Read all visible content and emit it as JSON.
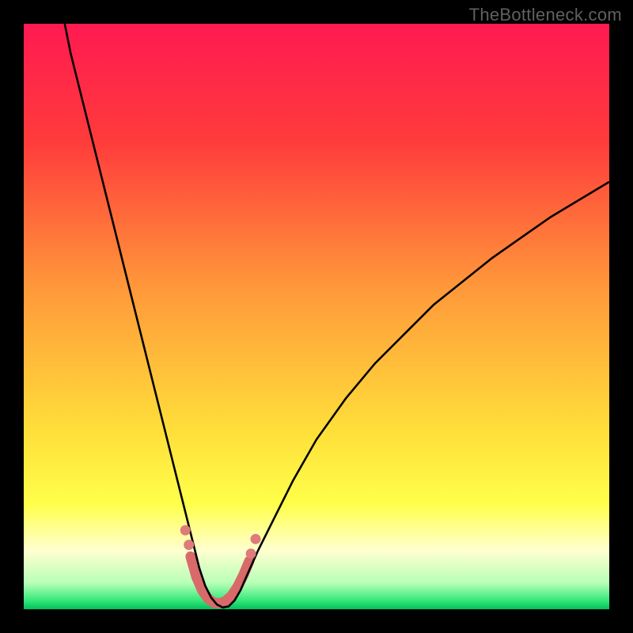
{
  "watermark": "TheBottleneck.com",
  "chart_data": {
    "type": "line",
    "title": "",
    "xlabel": "",
    "ylabel": "",
    "xlim": [
      0,
      100
    ],
    "ylim": [
      0,
      100
    ],
    "gradient_stops": [
      {
        "offset": 0,
        "color": "#ff1a52"
      },
      {
        "offset": 0.2,
        "color": "#ff3b3b"
      },
      {
        "offset": 0.45,
        "color": "#ff983a"
      },
      {
        "offset": 0.7,
        "color": "#ffe03a"
      },
      {
        "offset": 0.82,
        "color": "#ffff4a"
      },
      {
        "offset": 0.9,
        "color": "#ffffd0"
      },
      {
        "offset": 0.955,
        "color": "#b8ffb8"
      },
      {
        "offset": 0.985,
        "color": "#35e87a"
      },
      {
        "offset": 1.0,
        "color": "#00c05a"
      }
    ],
    "series": [
      {
        "name": "curve",
        "color": "#000000",
        "width": 2.6,
        "points": [
          [
            7,
            100
          ],
          [
            8,
            95
          ],
          [
            10,
            87
          ],
          [
            12,
            79
          ],
          [
            14,
            71
          ],
          [
            16,
            63
          ],
          [
            18,
            55
          ],
          [
            20,
            47
          ],
          [
            22,
            39
          ],
          [
            24,
            31
          ],
          [
            26,
            23
          ],
          [
            27.5,
            17
          ],
          [
            29,
            11
          ],
          [
            30,
            7
          ],
          [
            31,
            4
          ],
          [
            32,
            2
          ],
          [
            33,
            0.8
          ],
          [
            34,
            0.3
          ],
          [
            35,
            0.5
          ],
          [
            36,
            1.5
          ],
          [
            37,
            3.2
          ],
          [
            38,
            5.5
          ],
          [
            40,
            10
          ],
          [
            43,
            16
          ],
          [
            46,
            22
          ],
          [
            50,
            29
          ],
          [
            55,
            36
          ],
          [
            60,
            42
          ],
          [
            65,
            47
          ],
          [
            70,
            52
          ],
          [
            75,
            56
          ],
          [
            80,
            60
          ],
          [
            85,
            63.5
          ],
          [
            90,
            67
          ],
          [
            95,
            70
          ],
          [
            100,
            73
          ]
        ]
      },
      {
        "name": "highlight-segment",
        "color": "#d86a6a",
        "width": 13,
        "cap": "round",
        "points": [
          [
            28.5,
            9
          ],
          [
            29.5,
            5.5
          ],
          [
            30.5,
            3.2
          ],
          [
            31.5,
            1.8
          ],
          [
            32.5,
            1.1
          ],
          [
            33.5,
            1.0
          ],
          [
            34.5,
            1.4
          ],
          [
            35.5,
            2.3
          ],
          [
            36.5,
            3.8
          ],
          [
            37.5,
            5.8
          ],
          [
            38.5,
            8.2
          ]
        ]
      }
    ],
    "dots": {
      "color": "#de7b7b",
      "radius": 6.5,
      "points": [
        [
          27.6,
          13.5
        ],
        [
          28.2,
          11.0
        ],
        [
          38.8,
          9.5
        ],
        [
          39.6,
          12.0
        ]
      ]
    }
  }
}
